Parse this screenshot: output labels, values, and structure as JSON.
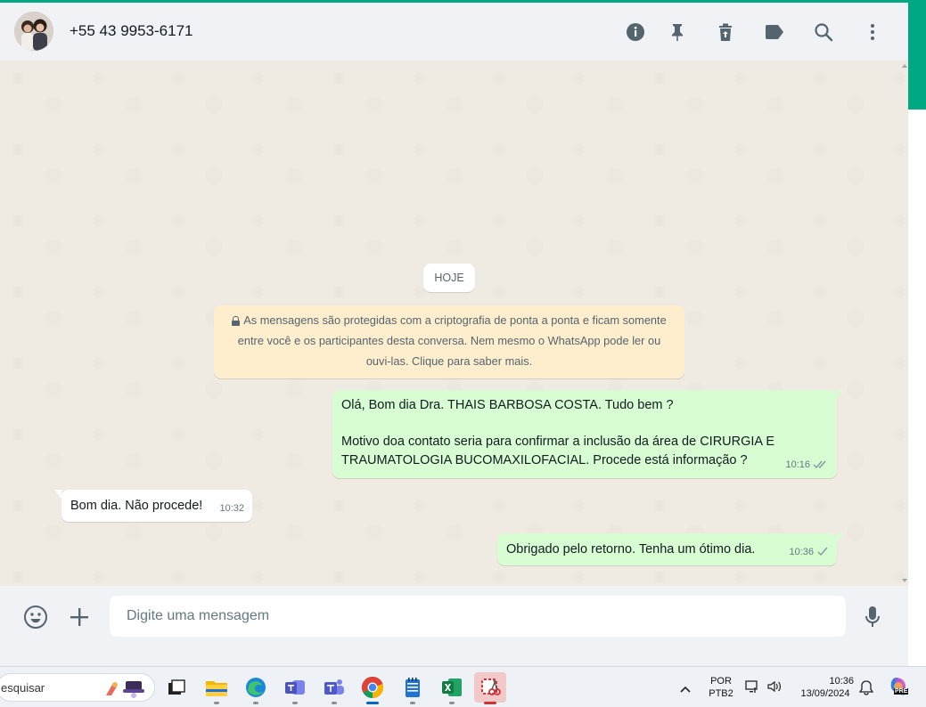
{
  "header": {
    "contact_name": "+55 43 9953-6171",
    "icons": [
      "info-icon",
      "pin-icon",
      "delete-icon",
      "label-icon",
      "search-icon",
      "menu-icon"
    ]
  },
  "chat": {
    "date_label": "HOJE",
    "encryption_notice": "As mensagens são protegidas com a criptografia de ponta a ponta e ficam somente entre você e os participantes desta conversa. Nem mesmo o WhatsApp pode ler ou ouvi-las. Clique para saber mais.",
    "messages": [
      {
        "direction": "outgoing",
        "lines": [
          "Olá, Bom dia Dra. THAIS BARBOSA COSTA. Tudo bem ?",
          "",
          "Motivo doa contato seria para confirmar a inclusão da área de  CIRURGIA E",
          "TRAUMATOLOGIA BUCOMAXILOFACIAL. Procede está informação ?"
        ],
        "time": "10:16",
        "status": "double-check"
      },
      {
        "direction": "incoming",
        "lines": [
          "Bom dia. Não procede!"
        ],
        "time": "10:32"
      },
      {
        "direction": "outgoing",
        "lines": [
          "Obrigado pelo retorno. Tenha um ótimo dia."
        ],
        "time": "10:36",
        "status": "single-check"
      }
    ]
  },
  "composer": {
    "placeholder": "Digite uma mensagem"
  },
  "taskbar": {
    "search_text": "esquisar",
    "apps": [
      "task-view",
      "file-explorer",
      "edge",
      "teams-work",
      "teams",
      "chrome",
      "notepad",
      "excel",
      "snipping-tool"
    ],
    "active_app": "snipping-tool",
    "lang_line1": "POR",
    "lang_line2": "PTB2",
    "time": "10:36",
    "date": "13/09/2024",
    "copilot_badge": "PRE"
  },
  "colors": {
    "accent": "#00a884",
    "outgoing_bubble": "#d9fdd3",
    "incoming_bubble": "#ffffff",
    "notice_bg": "#ffeecd",
    "chat_bg": "#efeae2",
    "read_check": "#8696a0"
  }
}
